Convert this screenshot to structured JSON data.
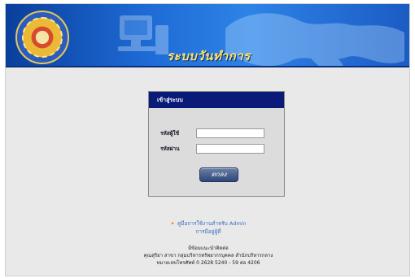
{
  "banner": {
    "title": "ระบบวันทำการ",
    "colors": {
      "primary": "#1e6bd6",
      "title": "#ffe36a"
    }
  },
  "login": {
    "header": "เข้าสู่ระบบ",
    "username_label": "รหัสผู้ใช้",
    "password_label": "รหัสผ่าน",
    "username_value": "",
    "password_value": "",
    "submit_label": "ตกลง"
  },
  "links": {
    "admin_manual": "คู่มือการใช้งานสำหรับ Admin",
    "user_manual": "การมีอยู่ผู้ที่"
  },
  "contact": {
    "heading": "มีข้อมแนะนำติดต่อ",
    "line1": "คุณสุริยา สาขา กลุ่มบริหารทรัพยากรบุคคล สำนักบริหารกลาง",
    "line2": "หมายเลขโทรศัพท์ 0 2628 5240 - 59 ต่อ 4206"
  }
}
